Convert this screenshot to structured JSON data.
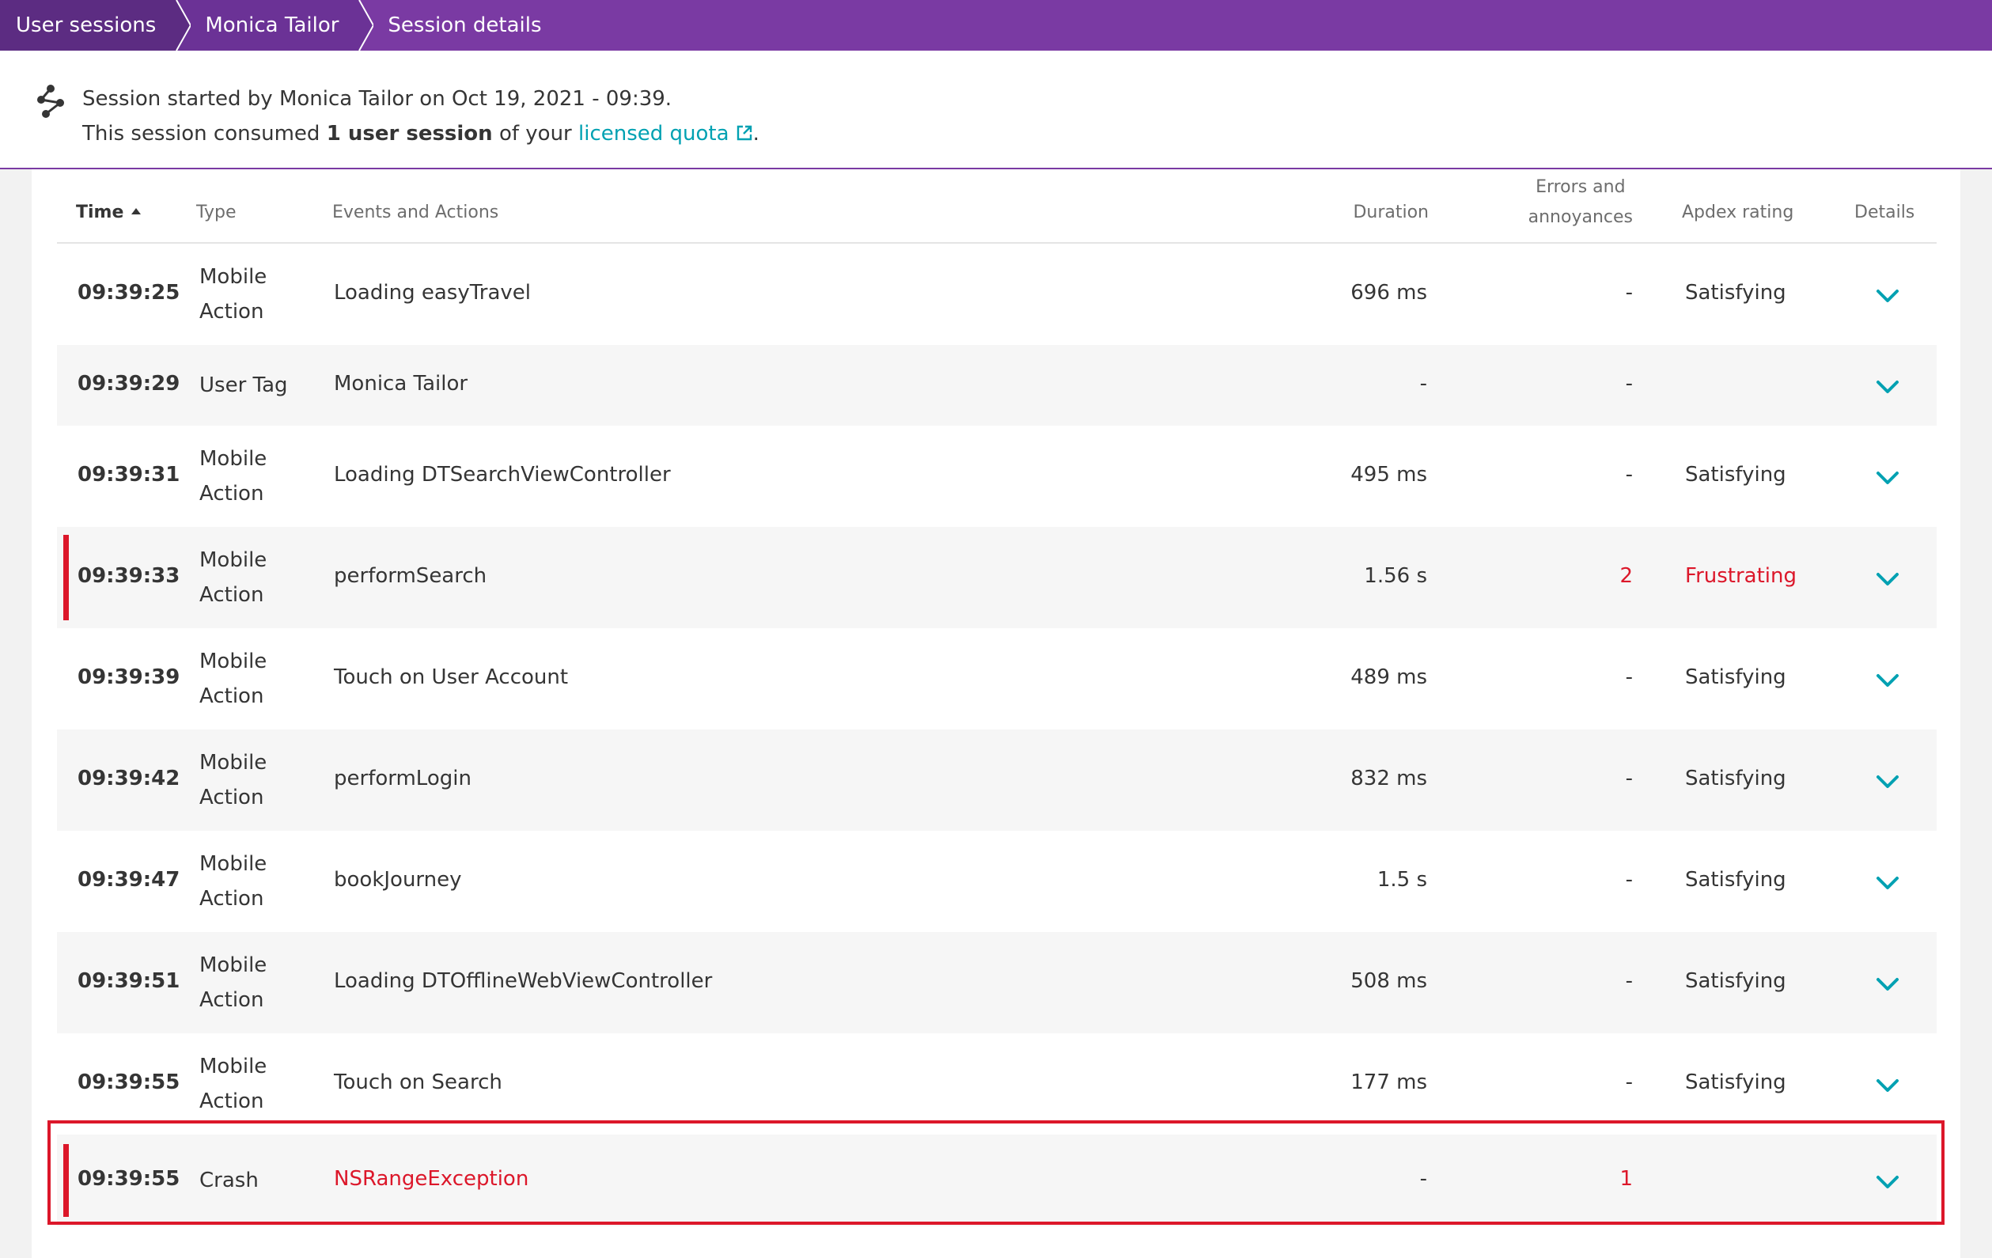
{
  "breadcrumb": {
    "items": [
      {
        "label": "User sessions"
      },
      {
        "label": "Monica Tailor"
      },
      {
        "label": "Session details"
      }
    ]
  },
  "header": {
    "line1": "Session started by Monica Tailor on Oct 19, 2021 - 09:39.",
    "line2_prefix": "This session consumed ",
    "line2_bold": "1 user session",
    "line2_middle": " of your ",
    "line2_link": "licensed quota",
    "line2_suffix": ".",
    "icon": "session-flow-icon"
  },
  "table": {
    "columns": {
      "time": "Time",
      "type": "Type",
      "events": "Events and Actions",
      "duration": "Duration",
      "errors_line1": "Errors and",
      "errors_line2": "annoyances",
      "apdex": "Apdex rating",
      "details": "Details"
    },
    "rows": [
      {
        "time": "09:39:25",
        "type1": "Mobile",
        "type2": "Action",
        "event": "Loading easyTravel",
        "duration": "696 ms",
        "errors": "-",
        "apdex": "Satisfying",
        "status": "ok"
      },
      {
        "time": "09:39:29",
        "type1": "User Tag",
        "type2": "",
        "event": "Monica Tailor",
        "duration": "-",
        "errors": "-",
        "apdex": "",
        "status": "ok"
      },
      {
        "time": "09:39:31",
        "type1": "Mobile",
        "type2": "Action",
        "event": "Loading DTSearchViewController",
        "duration": "495 ms",
        "errors": "-",
        "apdex": "Satisfying",
        "status": "ok"
      },
      {
        "time": "09:39:33",
        "type1": "Mobile",
        "type2": "Action",
        "event": "performSearch",
        "duration": "1.56 s",
        "errors": "2",
        "apdex": "Frustrating",
        "status": "error"
      },
      {
        "time": "09:39:39",
        "type1": "Mobile",
        "type2": "Action",
        "event": "Touch on User Account",
        "duration": "489 ms",
        "errors": "-",
        "apdex": "Satisfying",
        "status": "ok"
      },
      {
        "time": "09:39:42",
        "type1": "Mobile",
        "type2": "Action",
        "event": "performLogin",
        "duration": "832 ms",
        "errors": "-",
        "apdex": "Satisfying",
        "status": "ok"
      },
      {
        "time": "09:39:47",
        "type1": "Mobile",
        "type2": "Action",
        "event": "bookJourney",
        "duration": "1.5 s",
        "errors": "-",
        "apdex": "Satisfying",
        "status": "ok"
      },
      {
        "time": "09:39:51",
        "type1": "Mobile",
        "type2": "Action",
        "event": "Loading DTOfflineWebViewController",
        "duration": "508 ms",
        "errors": "-",
        "apdex": "Satisfying",
        "status": "ok"
      },
      {
        "time": "09:39:55",
        "type1": "Mobile",
        "type2": "Action",
        "event": "Touch on Search",
        "duration": "177 ms",
        "errors": "-",
        "apdex": "Satisfying",
        "status": "ok"
      },
      {
        "time": "09:39:55",
        "type1": "Crash",
        "type2": "",
        "event": "NSRangeException",
        "duration": "-",
        "errors": "1",
        "apdex": "",
        "status": "crash"
      }
    ]
  },
  "colors": {
    "brand_purple": "#7a3aa3",
    "link": "#00a1b2",
    "error": "#dc172a"
  }
}
